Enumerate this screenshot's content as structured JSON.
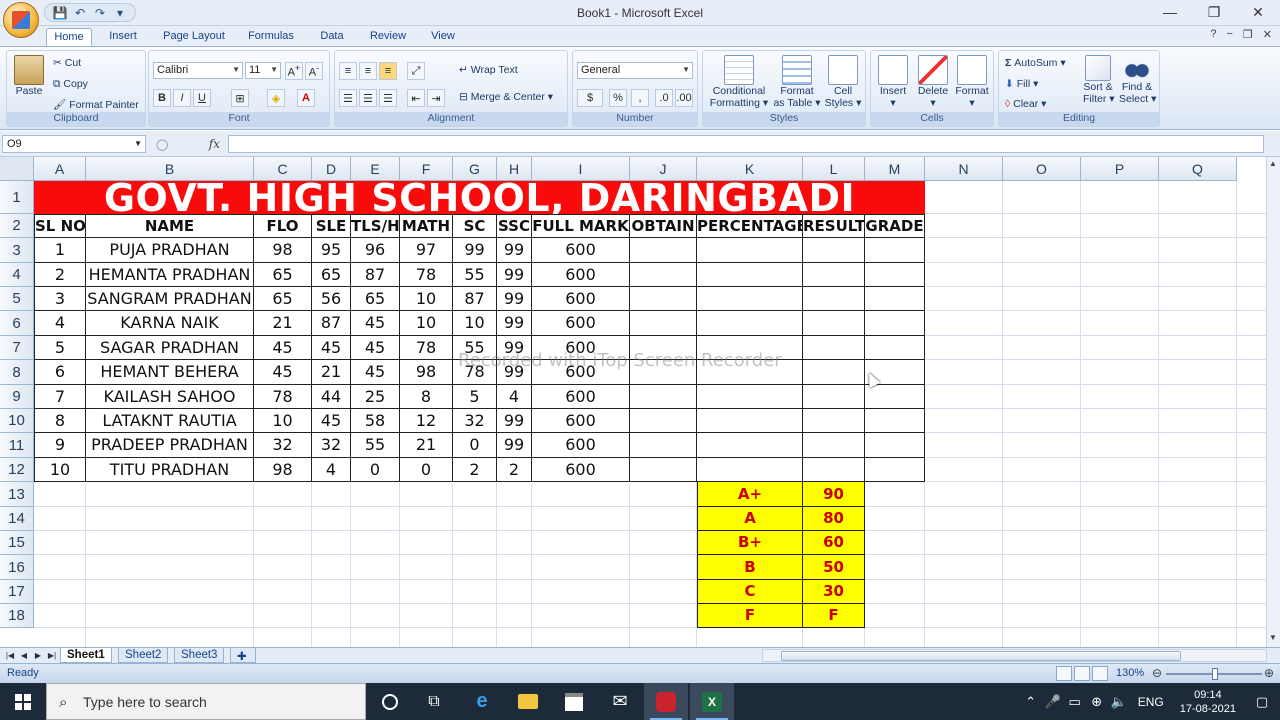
{
  "window": {
    "title": "Book1 - Microsoft Excel",
    "minimize": "—",
    "maximize": "❐",
    "close": "✕"
  },
  "qat": {
    "save": "💾",
    "undo": "↶",
    "redo": "↷",
    "more": "▾"
  },
  "tabs": [
    "Home",
    "Insert",
    "Page Layout",
    "Formulas",
    "Data",
    "Review",
    "View"
  ],
  "ribbon": {
    "clipboard": {
      "label": "Clipboard",
      "paste": "Paste",
      "cut": "Cut",
      "copy": "Copy",
      "format_painter": "Format Painter"
    },
    "font": {
      "label": "Font",
      "name": "Calibri",
      "size": "11",
      "bold": "B",
      "italic": "I",
      "underline": "U"
    },
    "alignment": {
      "label": "Alignment",
      "wrap": "Wrap Text",
      "merge": "Merge & Center"
    },
    "number": {
      "label": "Number",
      "format": "General",
      "percent": "%",
      "comma": ","
    },
    "styles": {
      "label": "Styles",
      "conditional": [
        "Conditional",
        "Formatting"
      ],
      "format_table": [
        "Format",
        "as Table"
      ],
      "cell_styles": [
        "Cell",
        "Styles"
      ]
    },
    "cells": {
      "label": "Cells",
      "insert": "Insert",
      "delete": "Delete",
      "format": "Format"
    },
    "editing": {
      "label": "Editing",
      "autosum": "AutoSum",
      "fill": "Fill",
      "clear": "Clear",
      "sort": [
        "Sort &",
        "Filter"
      ],
      "find": [
        "Find &",
        "Select"
      ]
    }
  },
  "formula_bar": {
    "name_box": "O9",
    "fx": "fx",
    "value": ""
  },
  "columns": [
    "A",
    "B",
    "C",
    "D",
    "E",
    "F",
    "G",
    "H",
    "I",
    "J",
    "K",
    "L",
    "M",
    "N",
    "O",
    "P",
    "Q"
  ],
  "rows": [
    "1",
    "2",
    "3",
    "4",
    "5",
    "6",
    "7",
    "8",
    "9",
    "10",
    "11",
    "12",
    "13",
    "14",
    "15",
    "16",
    "17",
    "18"
  ],
  "sheet": {
    "title": "GOVT. HIGH SCHOOL, DARINGBADI",
    "headers": [
      "SL NO",
      "NAME",
      "FLO",
      "SLE",
      "TLS/H",
      "MATH",
      "SC",
      "SSC",
      "FULL MARK",
      "OBTAIN",
      "PERCENTAGE",
      "RESULT",
      "GRADE"
    ],
    "students": [
      [
        "1",
        "PUJA PRADHAN",
        "98",
        "95",
        "96",
        "97",
        "99",
        "99",
        "600",
        "",
        "",
        "",
        ""
      ],
      [
        "2",
        "HEMANTA PRADHAN",
        "65",
        "65",
        "87",
        "78",
        "55",
        "99",
        "600",
        "",
        "",
        "",
        ""
      ],
      [
        "3",
        "SANGRAM PRADHAN",
        "65",
        "56",
        "65",
        "10",
        "87",
        "99",
        "600",
        "",
        "",
        "",
        ""
      ],
      [
        "4",
        "KARNA NAIK",
        "21",
        "87",
        "45",
        "10",
        "10",
        "99",
        "600",
        "",
        "",
        "",
        ""
      ],
      [
        "5",
        "SAGAR PRADHAN",
        "45",
        "45",
        "45",
        "78",
        "55",
        "99",
        "600",
        "",
        "",
        "",
        ""
      ],
      [
        "6",
        "HEMANT BEHERA",
        "45",
        "21",
        "45",
        "98",
        "78",
        "99",
        "600",
        "",
        "",
        "",
        ""
      ],
      [
        "7",
        "KAILASH SAHOO",
        "78",
        "44",
        "25",
        "8",
        "5",
        "4",
        "600",
        "",
        "",
        "",
        ""
      ],
      [
        "8",
        "LATAKNT RAUTIA",
        "10",
        "45",
        "58",
        "12",
        "32",
        "99",
        "600",
        "",
        "",
        "",
        ""
      ],
      [
        "9",
        "PRADEEP PRADHAN",
        "32",
        "32",
        "55",
        "21",
        "0",
        "99",
        "600",
        "",
        "",
        "",
        ""
      ],
      [
        "10",
        "TITU PRADHAN",
        "98",
        "4",
        "0",
        "0",
        "2",
        "2",
        "600",
        "",
        "",
        "",
        ""
      ]
    ],
    "grade_table": [
      [
        "A+",
        "90"
      ],
      [
        "A",
        "80"
      ],
      [
        "B+",
        "60"
      ],
      [
        "B",
        "50"
      ],
      [
        "C",
        "30"
      ],
      [
        "F",
        "F"
      ]
    ]
  },
  "watermark": "Recorded with iTop Screen Recorder",
  "sheet_tabs": [
    "Sheet1",
    "Sheet2",
    "Sheet3"
  ],
  "status": {
    "text": "Ready",
    "zoom": "130%"
  },
  "taskbar": {
    "search_placeholder": "Type here to search",
    "lang": "ENG",
    "time": "09:14",
    "date": "17-08-2021"
  },
  "colors": {
    "title_band": "#fa0b0b",
    "grade_fill": "#ffff00",
    "grade_text": "#cc0000"
  }
}
